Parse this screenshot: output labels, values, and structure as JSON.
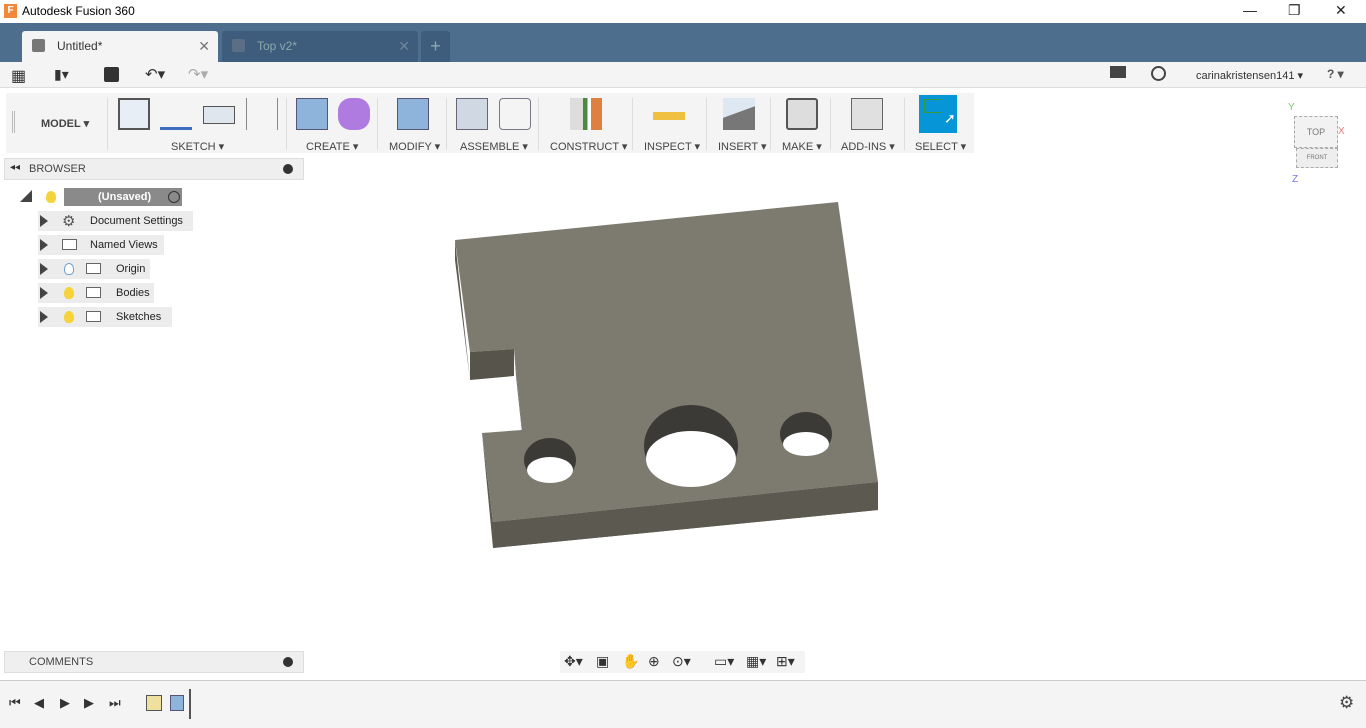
{
  "window": {
    "title": "Autodesk Fusion 360",
    "minimize": "—",
    "maximize": "❐",
    "close": "✕"
  },
  "tabs": [
    {
      "label": "Untitled*",
      "active": true
    },
    {
      "label": "Top v2*",
      "active": false
    }
  ],
  "new_tab": "+",
  "quickbar": {
    "user": "carinakristensen141 ▾",
    "help": "? ▾"
  },
  "ribbon": {
    "workspace": "MODEL ▾",
    "groups": [
      "SKETCH ▾",
      "CREATE ▾",
      "MODIFY ▾",
      "ASSEMBLE ▾",
      "CONSTRUCT ▾",
      "INSPECT ▾",
      "INSERT ▾",
      "MAKE ▾",
      "ADD-INS ▾",
      "SELECT ▾"
    ]
  },
  "browser": {
    "title": "BROWSER",
    "root": "(Unsaved)",
    "items": [
      {
        "label": "Document Settings",
        "icon": "gear-icon"
      },
      {
        "label": "Named Views",
        "icon": "folder-icon"
      },
      {
        "label": "Origin",
        "icon": "bulb-icon"
      },
      {
        "label": "Bodies",
        "icon": "bulb-icon"
      },
      {
        "label": "Sketches",
        "icon": "bulb-icon"
      }
    ]
  },
  "comments": {
    "title": "COMMENTS"
  },
  "viewcube": {
    "top": "TOP",
    "front": "FRONT",
    "x": "X",
    "y": "Y",
    "z": "Z"
  },
  "colors": {
    "tabbar": "#4e6e8e",
    "select_active": "#0696d7",
    "body_top": "#7d7a6f",
    "body_side": "#5e5b52"
  }
}
